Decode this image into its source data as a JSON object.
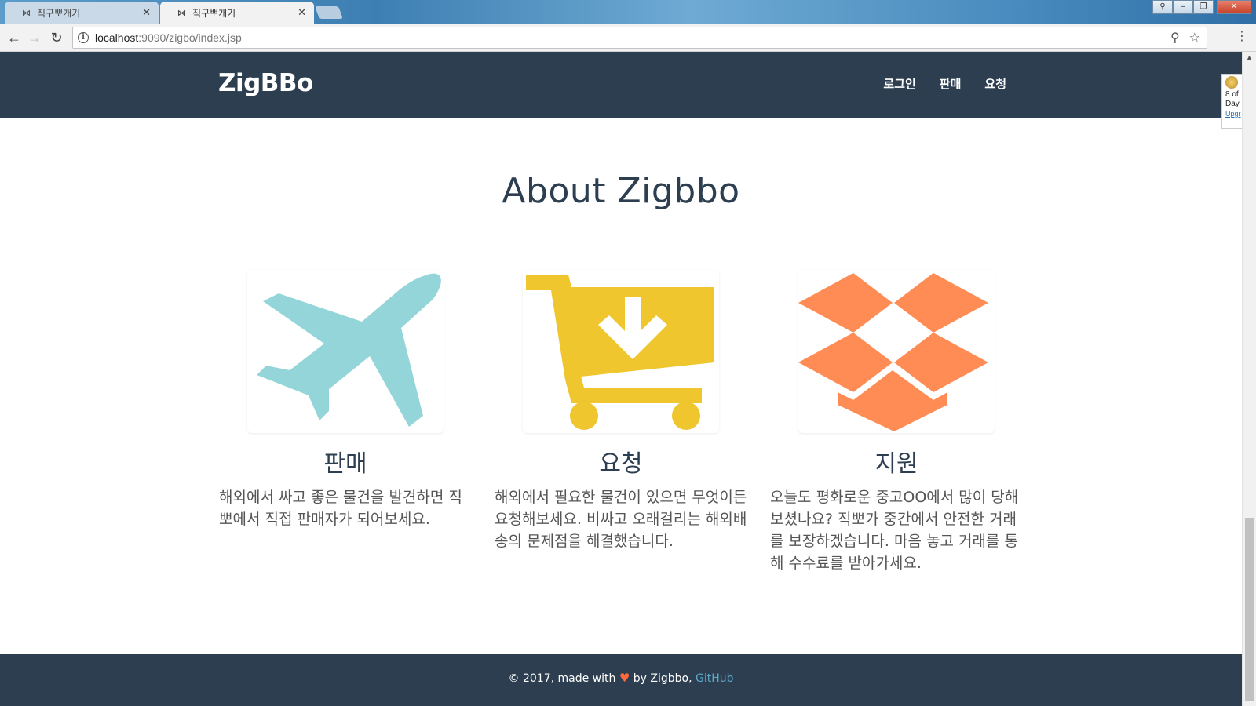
{
  "browser": {
    "tabs": [
      {
        "title": "직구뽀개기",
        "active": false
      },
      {
        "title": "직구뽀개기",
        "active": true
      }
    ],
    "tab_icon": "bowtie-icon",
    "url_host": "localhost",
    "url_rest": ":9090/zigbo/index.jsp"
  },
  "site": {
    "brand": "ZigBBo",
    "nav": [
      "로그인",
      "판매",
      "요청"
    ],
    "accent_dark": "#2c3e50"
  },
  "widget": {
    "line1": "8 of",
    "line2": "Day",
    "link": "Upgr"
  },
  "about": {
    "title": "About Zigbbo",
    "features": [
      {
        "icon": "airplane-icon",
        "color": "#93d5d8",
        "heading": "판매",
        "text": "해외에서 싸고 좋은 물건을 발견하면 직뽀에서 직접 판매자가 되어보세요."
      },
      {
        "icon": "cart-download-icon",
        "color": "#efc62d",
        "heading": "요청",
        "text": "해외에서 필요한 물건이 있으면 무엇이든 요청해보세요. 비싸고 오래걸리는 해외배송의 문제점을 해결했습니다."
      },
      {
        "icon": "dropbox-icon",
        "color": "#ff8c54",
        "heading": "지원",
        "text": "오늘도 평화로운 중고OO에서 많이 당해보셨나요? 직뽀가 중간에서 안전한 거래를 보장하겠습니다. 마음 놓고 거래를 통해 수수료를 받아가세요."
      }
    ]
  },
  "footer": {
    "prefix": "© 2017, made with",
    "middle": "by Zigbbo,",
    "link": "GitHub"
  }
}
